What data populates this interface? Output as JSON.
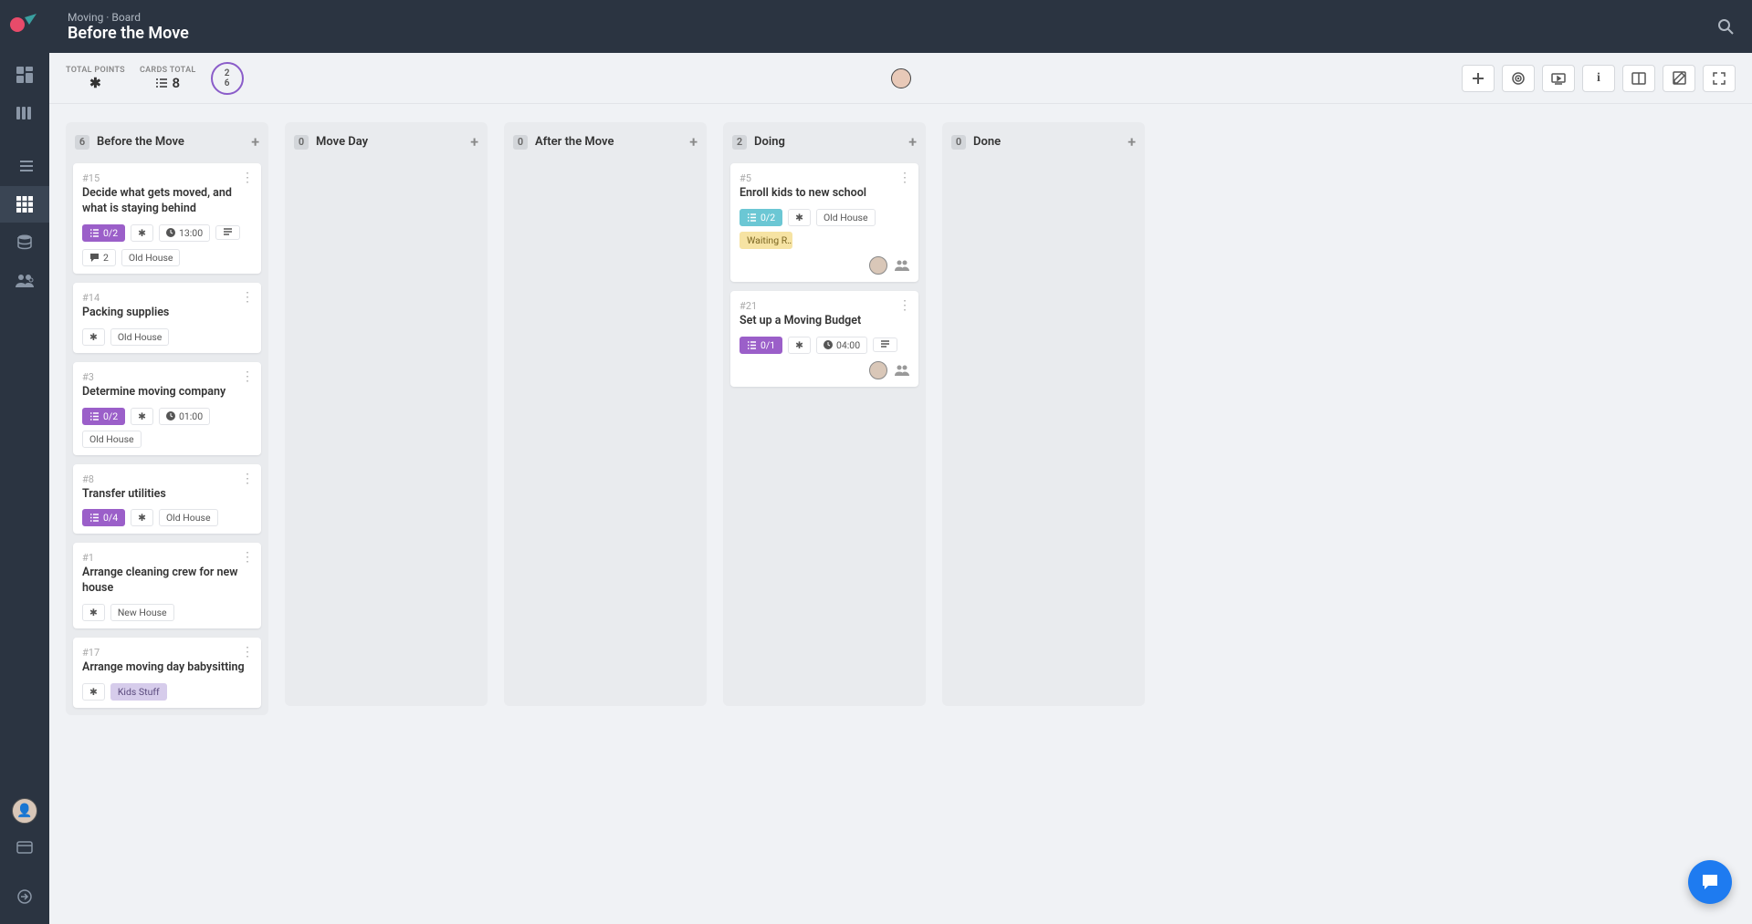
{
  "breadcrumb": "Moving · Board",
  "title": "Before the Move",
  "stats": {
    "points_label": "TOTAL POINTS",
    "points_value": "*",
    "cards_label": "CARDS TOTAL",
    "cards_value": "8",
    "ring_done": "2",
    "ring_total": "6"
  },
  "columns": [
    {
      "name": "Before the Move",
      "count": "6",
      "cards": [
        {
          "id": "#15",
          "title": "Decide what gets moved, and what is staying behind",
          "checklist": "0/2",
          "checklist_color": "purple",
          "points": true,
          "time": "13:00",
          "desc_icon": true,
          "comments": "2",
          "tags": [
            "Old House"
          ]
        },
        {
          "id": "#14",
          "title": "Packing supplies",
          "points": true,
          "tags": [
            "Old House"
          ]
        },
        {
          "id": "#3",
          "title": "Determine moving company",
          "checklist": "0/2",
          "checklist_color": "purple",
          "points": true,
          "time": "01:00",
          "tags": [
            "Old House"
          ]
        },
        {
          "id": "#8",
          "title": "Transfer utilities",
          "checklist": "0/4",
          "checklist_color": "purple",
          "points": true,
          "tags": [
            "Old House"
          ]
        },
        {
          "id": "#1",
          "title": "Arrange cleaning crew for new house",
          "points": true,
          "tags": [
            "New House"
          ]
        },
        {
          "id": "#17",
          "title": "Arrange moving day babysitting",
          "points": true,
          "tags_lilac": [
            "Kids Stuff"
          ]
        }
      ]
    },
    {
      "name": "Move Day",
      "count": "0",
      "cards": []
    },
    {
      "name": "After the Move",
      "count": "0",
      "cards": []
    },
    {
      "name": "Doing",
      "count": "2",
      "cards": [
        {
          "id": "#5",
          "title": "Enroll kids to new school",
          "checklist": "0/2",
          "checklist_color": "teal",
          "points": true,
          "tags": [
            "Old House"
          ],
          "tags_yellow": [
            "Waiting R…"
          ],
          "assignee": true
        },
        {
          "id": "#21",
          "title": "Set up a Moving Budget",
          "checklist": "0/1",
          "checklist_color": "purple",
          "points": true,
          "time": "04:00",
          "desc_icon": true,
          "assignee": true
        }
      ]
    },
    {
      "name": "Done",
      "count": "0",
      "cards": []
    }
  ]
}
